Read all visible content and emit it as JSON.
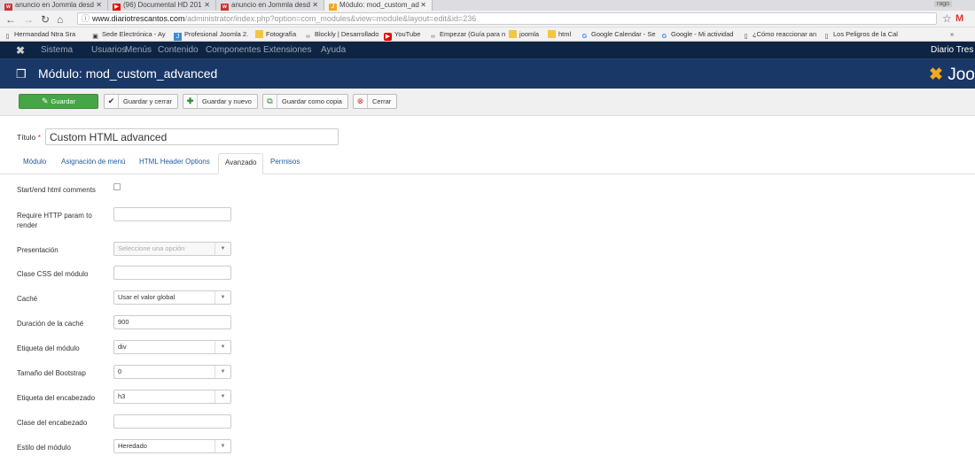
{
  "browser": {
    "tabs": [
      {
        "title": "anuncio en Jommla desd",
        "icon": "w"
      },
      {
        "title": "(96) Documental HD 201",
        "icon": "▶"
      },
      {
        "title": "anuncio en Jommla desd",
        "icon": "w"
      },
      {
        "title": "Módulo: mod_custom_ad",
        "icon": "J"
      }
    ],
    "window_badge": "rago",
    "url_domain": "www.diariotrescantos.com",
    "url_path": "/administrator/index.php?option=com_modules&view=module&layout=edit&id=236",
    "bookmarks": [
      "Hermandad Ntra Sra",
      "Sede Electrónica - Ay",
      "Profesional Joomla 2.",
      "Fotografía",
      "Blockly | Desarrollado",
      "YouTube",
      "Empezar (Guía para n",
      "joomla",
      "html",
      "Google Calendar - Se",
      "Google - Mi actividad",
      "¿Cómo reaccionar an",
      "Los Peligros de la Cal"
    ],
    "bookmarks_more": "»"
  },
  "joomla_nav": {
    "menu": [
      "Sistema",
      "Usuarios",
      "Menús",
      "Contenido",
      "Componentes",
      "Extensiones",
      "Ayuda"
    ],
    "site_name": "Diario Tres C"
  },
  "header": {
    "title": "Módulo: mod_custom_advanced",
    "logo_text": "Joo"
  },
  "toolbar": {
    "save": "Guardar",
    "save_close": "Guardar y cerrar",
    "save_new": "Guardar y nuevo",
    "save_copy": "Guardar como copia",
    "close": "Cerrar"
  },
  "form": {
    "title_label": "Título",
    "title_required": "*",
    "title_value": "Custom HTML advanced",
    "tabs": [
      "Módulo",
      "Asignación de menú",
      "HTML Header Options",
      "Avanzado",
      "Permisos"
    ],
    "active_tab": "Avanzado",
    "fields": [
      {
        "label": "Start/end html comments",
        "type": "checkbox",
        "value": ""
      },
      {
        "label": "Require HTTP param to render",
        "type": "input",
        "value": ""
      },
      {
        "label": "Presentación",
        "type": "select",
        "value": "Seleccione una opción",
        "placeholder": true
      },
      {
        "label": "Clase CSS del módulo",
        "type": "input",
        "value": ""
      },
      {
        "label": "Caché",
        "type": "select",
        "value": "Usar el valor global"
      },
      {
        "label": "Duración de la caché",
        "type": "input",
        "value": "900"
      },
      {
        "label": "Etiqueta del módulo",
        "type": "select",
        "value": "div"
      },
      {
        "label": "Tamaño del Bootstrap",
        "type": "select",
        "value": "0"
      },
      {
        "label": "Etiqueta del encabezado",
        "type": "select",
        "value": "h3"
      },
      {
        "label": "Clase del encabezado",
        "type": "input",
        "value": ""
      },
      {
        "label": "Estilo del módulo",
        "type": "select",
        "value": "Heredado"
      }
    ]
  },
  "colors": {
    "nav_bg": "#0d2444",
    "header_bg": "#1a3867",
    "save_green": "#46a546",
    "link_blue": "#1f5a9c",
    "joomla_orange": "#f4a81d"
  }
}
